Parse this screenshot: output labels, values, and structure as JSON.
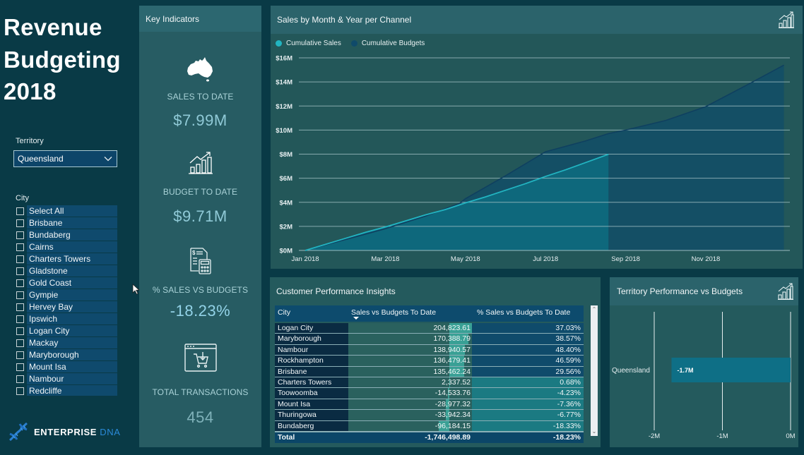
{
  "report": {
    "title_lines": [
      "Revenue",
      "Budgeting",
      "2018"
    ]
  },
  "territory_slicer": {
    "label": "Territory",
    "selected": "Queensland"
  },
  "city_slicer": {
    "label": "City",
    "items": [
      "Select All",
      "Brisbane",
      "Bundaberg",
      "Cairns",
      "Charters Towers",
      "Gladstone",
      "Gold Coast",
      "Gympie",
      "Hervey Bay",
      "Ipswich",
      "Logan City",
      "Mackay",
      "Maryborough",
      "Mount Isa",
      "Nambour",
      "Redcliffe"
    ]
  },
  "brand": {
    "name_part1": "ENTERPRISE",
    "name_part2": "DNA"
  },
  "kpis": {
    "title": "Key Indicators",
    "items": [
      {
        "icon": "australia-map-icon",
        "label": "SALES TO DATE",
        "value": "$7.99M"
      },
      {
        "icon": "growth-bar-chart-icon",
        "label": "BUDGET TO DATE",
        "value": "$9.71M"
      },
      {
        "icon": "invoice-calculator-icon",
        "label": "% SALES VS BUDGETS",
        "value": "-18.23%"
      },
      {
        "icon": "shopping-cart-window-icon",
        "label": "TOTAL TRANSACTIONS",
        "value": "454"
      }
    ]
  },
  "table": {
    "title": "Customer Performance Insights",
    "columns": [
      "City",
      "Sales vs Budgets To Date",
      "% Sales vs Budgets To Date"
    ],
    "sorted_by": "Sales vs Budgets To Date",
    "sort_direction": "descending",
    "rows": [
      {
        "city": "Logan City",
        "sales_vs_budget": "204,823.61",
        "pct": "37.03%"
      },
      {
        "city": "Maryborough",
        "sales_vs_budget": "170,388.79",
        "pct": "38.57%"
      },
      {
        "city": "Nambour",
        "sales_vs_budget": "138,940.57",
        "pct": "48.40%"
      },
      {
        "city": "Rockhampton",
        "sales_vs_budget": "136,479.41",
        "pct": "46.59%"
      },
      {
        "city": "Brisbane",
        "sales_vs_budget": "135,462.24",
        "pct": "29.56%"
      },
      {
        "city": "Charters Towers",
        "sales_vs_budget": "2,337.52",
        "pct": "0.68%"
      },
      {
        "city": "Toowoomba",
        "sales_vs_budget": "-14,533.76",
        "pct": "-4.23%"
      },
      {
        "city": "Mount Isa",
        "sales_vs_budget": "-28,977.32",
        "pct": "-7.36%"
      },
      {
        "city": "Thuringowa",
        "sales_vs_budget": "-33,942.34",
        "pct": "-6.77%"
      },
      {
        "city": "Bundaberg",
        "sales_vs_budget": "-96,184.15",
        "pct": "-18.33%"
      }
    ],
    "total": {
      "label": "Total",
      "sales_vs_budget": "-1,746,498.89",
      "pct": "-18.23%"
    }
  },
  "colors": {
    "background": "#093a46",
    "panel": "#245a5d",
    "sales": "#22b4c1",
    "sales_area": "#0e687c",
    "budget": "#0f4a6a",
    "budget_area": "#144f66",
    "bar": "#0e6f86",
    "brand_blue": "#2a8ad8",
    "kpi_value": "#90cad7"
  },
  "chart_data": [
    {
      "type": "area",
      "title": "Sales by Month & Year per Channel",
      "x_unit": "months since 1 Jan 2018",
      "xlabel": "",
      "ylabel": "",
      "x_ticks": [
        0,
        2,
        4,
        6,
        8,
        10
      ],
      "x_tick_labels": [
        "Jan 2018",
        "Mar 2018",
        "May 2018",
        "Jul 2018",
        "Sep 2018",
        "Nov 2018"
      ],
      "y_ticks": [
        0,
        2,
        4,
        6,
        8,
        10,
        12,
        14,
        16
      ],
      "y_tick_labels": [
        "$0M",
        "$2M",
        "$4M",
        "$6M",
        "$8M",
        "$10M",
        "$12M",
        "$14M",
        "$16M"
      ],
      "ylim": [
        0,
        16
      ],
      "y_unit": "$M",
      "grid": true,
      "legend_position": "top-left",
      "series": [
        {
          "name": "Cumulative Sales",
          "color": "#22b4c1",
          "points": [
            [
              0,
              0
            ],
            [
              0.5,
              0.5
            ],
            [
              1,
              1.0
            ],
            [
              1.5,
              1.5
            ],
            [
              2,
              1.95
            ],
            [
              2.5,
              2.45
            ],
            [
              3,
              2.95
            ],
            [
              3.5,
              3.4
            ],
            [
              4,
              3.95
            ],
            [
              4.5,
              4.45
            ],
            [
              5,
              5.0
            ],
            [
              5.5,
              5.55
            ],
            [
              6,
              6.15
            ],
            [
              6.5,
              6.7
            ],
            [
              7,
              7.3
            ],
            [
              7.57,
              7.99
            ]
          ]
        },
        {
          "name": "Cumulative Budgets",
          "color": "#0f4a6a",
          "points": [
            [
              0,
              0
            ],
            [
              1,
              0.9
            ],
            [
              2,
              1.8
            ],
            [
              3,
              2.85
            ],
            [
              3.85,
              3.9
            ],
            [
              4,
              4.3
            ],
            [
              5,
              6.2
            ],
            [
              6,
              8.2
            ],
            [
              7,
              9.1
            ],
            [
              7.57,
              9.71
            ],
            [
              8,
              10.0
            ],
            [
              9,
              10.8
            ],
            [
              10,
              11.95
            ],
            [
              11,
              13.7
            ],
            [
              11.95,
              15.4
            ]
          ]
        }
      ]
    },
    {
      "type": "bar",
      "orientation": "horizontal",
      "title": "Territory Performance vs Budgets",
      "categories": [
        "Queensland"
      ],
      "values": [
        -1746498.89
      ],
      "data_labels": [
        "-1.7M"
      ],
      "x_ticks": [
        -2000000,
        -1000000,
        0
      ],
      "x_tick_labels": [
        "-2M",
        "-1M",
        "0M"
      ],
      "xlim": [
        -2000000,
        0
      ],
      "grid": true
    }
  ]
}
